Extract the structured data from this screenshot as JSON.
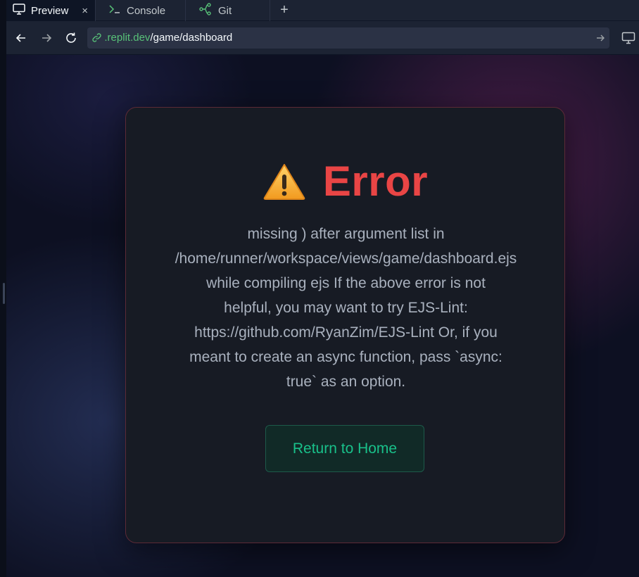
{
  "tabs": [
    {
      "label": "Preview",
      "icon": "monitor-icon",
      "active": true,
      "close": "×"
    },
    {
      "label": "Console",
      "icon": "terminal-icon",
      "active": false
    },
    {
      "label": "Git",
      "icon": "git-branch-icon",
      "active": false
    }
  ],
  "add_tab_label": "+",
  "address": {
    "host": ".replit.dev",
    "path": "/game/dashboard"
  },
  "page": {
    "title": "Error",
    "message_lines": [
      "missing ) after argument list in",
      "/home/runner/workspace/views/game/dashboard.ejs",
      "while compiling ejs If the above error is not",
      "helpful, you may want to try EJS-Lint:",
      "https://github.com/RyanZim/EJS-Lint Or, if you",
      "meant to create an async function, pass `async:",
      "true` as an option."
    ],
    "button_label": "Return to Home"
  },
  "colors": {
    "error": "#e94545",
    "accent": "#19c08a",
    "host": "#58c178"
  }
}
